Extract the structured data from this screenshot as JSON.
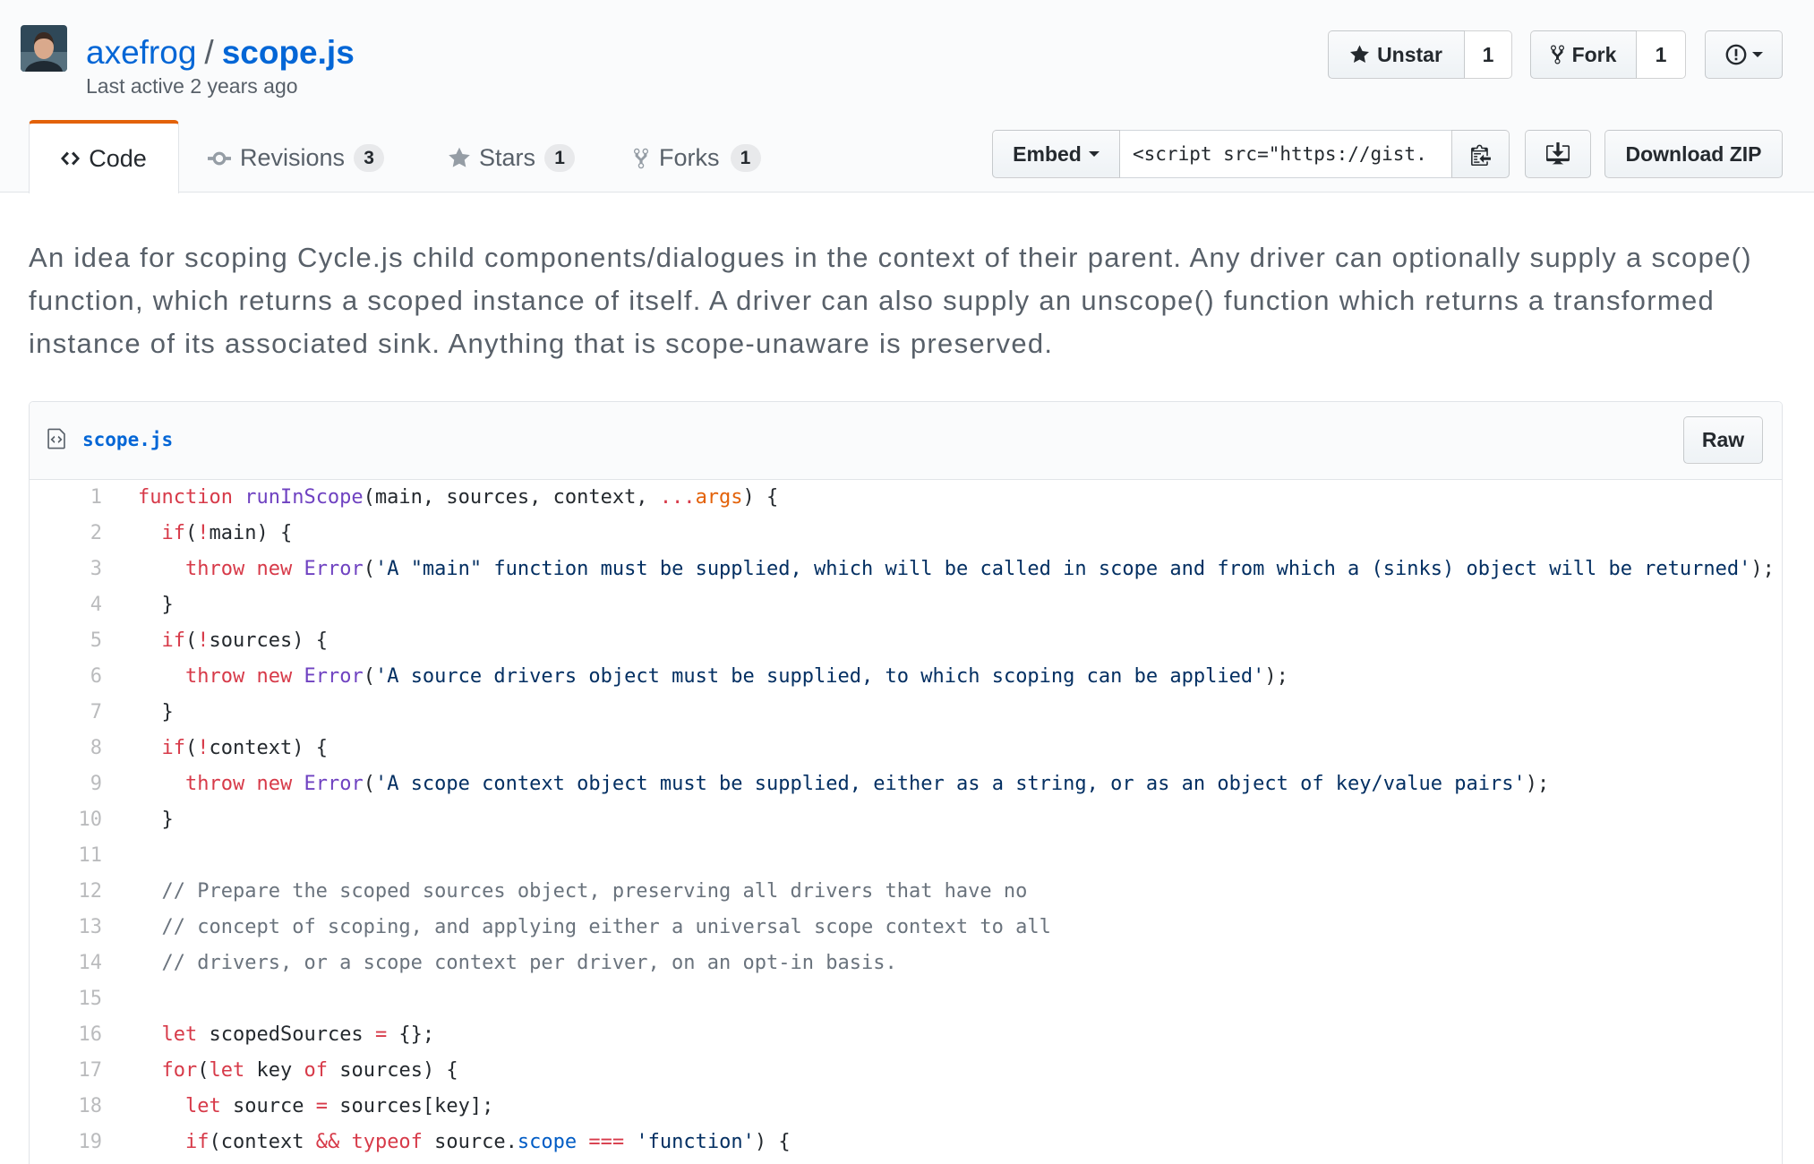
{
  "colors": {
    "link": "#0366d6",
    "text": "#24292e",
    "muted": "#586069",
    "tab_accent": "#e36209",
    "keyword": "#d73a49",
    "entity": "#6f42c1",
    "string": "#032f62",
    "comment": "#6a737d",
    "constant": "#005cc5",
    "variable": "#e36209"
  },
  "header": {
    "avatar_icon": "avatar",
    "owner": "axefrog",
    "separator": "/",
    "gist_name": "scope.js",
    "last_active": "Last active 2 years ago"
  },
  "actions": {
    "star": {
      "icon": "star-icon",
      "label": "Unstar",
      "count": "1"
    },
    "fork": {
      "icon": "fork-icon",
      "label": "Fork",
      "count": "1"
    },
    "report": {
      "icon": "report-icon",
      "menu_icon": "chevron-down-icon"
    }
  },
  "tabs": [
    {
      "icon": "code-icon",
      "label": "Code",
      "selected": true
    },
    {
      "icon": "git-commit-icon",
      "label": "Revisions",
      "count": "3",
      "selected": false
    },
    {
      "icon": "star-icon",
      "label": "Stars",
      "count": "1",
      "selected": false
    },
    {
      "icon": "fork-icon",
      "label": "Forks",
      "count": "1",
      "selected": false
    }
  ],
  "embed": {
    "label": "Embed",
    "value": "<script src=\"https://gist.",
    "copy_icon": "clipboard-icon"
  },
  "download": {
    "icon": "desktop-download-icon",
    "zip_label": "Download ZIP"
  },
  "description": "An idea for scoping Cycle.js child components/dialogues in the context of their parent. Any driver can optionally supply a scope() function, which returns a scoped instance of itself. A driver can also supply an unscope() function which returns a transformed instance of its associated sink. Anything that is scope-unaware is preserved.",
  "file": {
    "icon": "file-code-icon",
    "name": "scope.js",
    "raw_label": "Raw",
    "lines": [
      {
        "n": 1,
        "t": [
          [
            "function",
            "k"
          ],
          [
            " ",
            ""
          ],
          [
            "runInScope",
            "e"
          ],
          [
            "(main, sources, context, ",
            ""
          ],
          [
            "...",
            "k"
          ],
          [
            "args",
            "v"
          ],
          [
            ") {",
            ""
          ]
        ]
      },
      {
        "n": 2,
        "t": [
          [
            "  ",
            ""
          ],
          [
            "if",
            "k"
          ],
          [
            "(",
            ""
          ],
          [
            "!",
            "k"
          ],
          [
            "main) {",
            ""
          ]
        ]
      },
      {
        "n": 3,
        "t": [
          [
            "    ",
            ""
          ],
          [
            "throw",
            "k"
          ],
          [
            " ",
            ""
          ],
          [
            "new",
            "k"
          ],
          [
            " ",
            ""
          ],
          [
            "Error",
            "e"
          ],
          [
            "(",
            ""
          ],
          [
            "'A \"main\" function must be supplied, which will be called in scope and from which a (sinks) object will be returned'",
            "s"
          ],
          [
            ");",
            ""
          ]
        ]
      },
      {
        "n": 4,
        "t": [
          [
            "  }",
            ""
          ]
        ]
      },
      {
        "n": 5,
        "t": [
          [
            "  ",
            ""
          ],
          [
            "if",
            "k"
          ],
          [
            "(",
            ""
          ],
          [
            "!",
            "k"
          ],
          [
            "sources) {",
            ""
          ]
        ]
      },
      {
        "n": 6,
        "t": [
          [
            "    ",
            ""
          ],
          [
            "throw",
            "k"
          ],
          [
            " ",
            ""
          ],
          [
            "new",
            "k"
          ],
          [
            " ",
            ""
          ],
          [
            "Error",
            "e"
          ],
          [
            "(",
            ""
          ],
          [
            "'A source drivers object must be supplied, to which scoping can be applied'",
            "s"
          ],
          [
            ");",
            ""
          ]
        ]
      },
      {
        "n": 7,
        "t": [
          [
            "  }",
            ""
          ]
        ]
      },
      {
        "n": 8,
        "t": [
          [
            "  ",
            ""
          ],
          [
            "if",
            "k"
          ],
          [
            "(",
            ""
          ],
          [
            "!",
            "k"
          ],
          [
            "context) {",
            ""
          ]
        ]
      },
      {
        "n": 9,
        "t": [
          [
            "    ",
            ""
          ],
          [
            "throw",
            "k"
          ],
          [
            " ",
            ""
          ],
          [
            "new",
            "k"
          ],
          [
            " ",
            ""
          ],
          [
            "Error",
            "e"
          ],
          [
            "(",
            ""
          ],
          [
            "'A scope context object must be supplied, either as a string, or as an object of key/value pairs'",
            "s"
          ],
          [
            ");",
            ""
          ]
        ]
      },
      {
        "n": 10,
        "t": [
          [
            "  }",
            ""
          ]
        ]
      },
      {
        "n": 11,
        "t": []
      },
      {
        "n": 12,
        "t": [
          [
            "  ",
            ""
          ],
          [
            "// Prepare the scoped sources object, preserving all drivers that have no",
            "c"
          ]
        ]
      },
      {
        "n": 13,
        "t": [
          [
            "  ",
            ""
          ],
          [
            "// concept of scoping, and applying either a universal scope context to all",
            "c"
          ]
        ]
      },
      {
        "n": 14,
        "t": [
          [
            "  ",
            ""
          ],
          [
            "// drivers, or a scope context per driver, on an opt-in basis.",
            "c"
          ]
        ]
      },
      {
        "n": 15,
        "t": []
      },
      {
        "n": 16,
        "t": [
          [
            "  ",
            ""
          ],
          [
            "let",
            "k"
          ],
          [
            " scopedSources ",
            ""
          ],
          [
            "=",
            "k"
          ],
          [
            " {};",
            ""
          ]
        ]
      },
      {
        "n": 17,
        "t": [
          [
            "  ",
            ""
          ],
          [
            "for",
            "k"
          ],
          [
            "(",
            ""
          ],
          [
            "let",
            "k"
          ],
          [
            " key ",
            ""
          ],
          [
            "of",
            "k"
          ],
          [
            " sources) {",
            ""
          ]
        ]
      },
      {
        "n": 18,
        "t": [
          [
            "    ",
            ""
          ],
          [
            "let",
            "k"
          ],
          [
            " source ",
            ""
          ],
          [
            "=",
            "k"
          ],
          [
            " sources[key];",
            ""
          ]
        ]
      },
      {
        "n": 19,
        "t": [
          [
            "    ",
            ""
          ],
          [
            "if",
            "k"
          ],
          [
            "(context ",
            ""
          ],
          [
            "&&",
            "k"
          ],
          [
            " ",
            ""
          ],
          [
            "typeof",
            "k"
          ],
          [
            " source.",
            ""
          ],
          [
            "scope",
            "n"
          ],
          [
            " ",
            ""
          ],
          [
            "===",
            "k"
          ],
          [
            " ",
            ""
          ],
          [
            "'function'",
            "s"
          ],
          [
            ") {",
            ""
          ]
        ]
      }
    ]
  }
}
